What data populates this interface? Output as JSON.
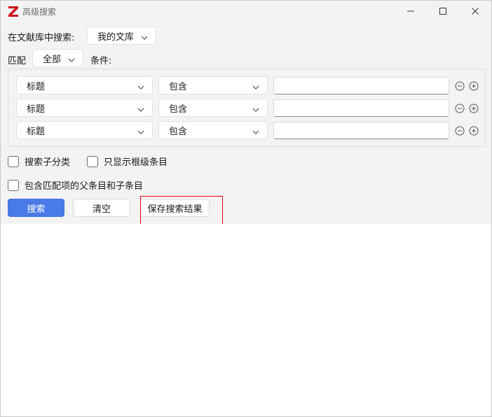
{
  "window": {
    "title": "高级搜索"
  },
  "search_in": {
    "label": "在文献库中搜索:",
    "library": "我的文库"
  },
  "match": {
    "label": "匹配",
    "mode": "全部",
    "conditions_label": "条件:"
  },
  "conditions": [
    {
      "field": "标题",
      "operator": "包含",
      "value": ""
    },
    {
      "field": "标题",
      "operator": "包含",
      "value": ""
    },
    {
      "field": "标题",
      "operator": "包含",
      "value": ""
    }
  ],
  "options": {
    "search_subcollections": "搜索子分类",
    "show_top_level_only": "只显示根级条目",
    "include_parent_child": "包含匹配项的父条目和子条目"
  },
  "buttons": {
    "search": "搜索",
    "clear": "清空",
    "save_search": "保存搜索结果"
  },
  "colors": {
    "logo_red": "#d0131a",
    "primary_blue": "#4a7ae8",
    "highlight_red": "#e3000f",
    "panel_bg": "#f3f3f3"
  },
  "icons": {
    "logo": "zotero-z-logo",
    "minimize": "minimize-icon",
    "maximize": "maximize-icon",
    "close": "close-icon",
    "dropdown": "chevron-down-icon",
    "remove": "minus-circle-icon",
    "add": "plus-circle-icon"
  }
}
